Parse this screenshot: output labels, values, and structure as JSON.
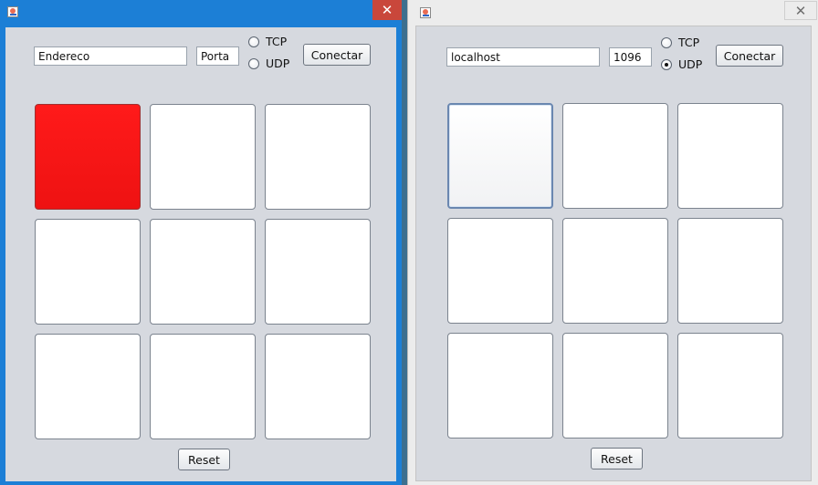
{
  "left_window": {
    "address_value": "Endereco",
    "port_value": "Porta",
    "radio_tcp_label": "TCP",
    "radio_udp_label": "UDP",
    "selected_protocol": "none",
    "connect_label": "Conectar",
    "reset_label": "Reset",
    "board": {
      "cells": [
        "red",
        "empty",
        "empty",
        "empty",
        "empty",
        "empty",
        "empty",
        "empty",
        "empty"
      ],
      "fill_color_red": "#ff1a1a"
    }
  },
  "right_window": {
    "address_value": "localhost",
    "port_value": "1096",
    "radio_tcp_label": "TCP",
    "radio_udp_label": "UDP",
    "selected_protocol": "UDP",
    "connect_label": "Conectar",
    "reset_label": "Reset",
    "board": {
      "cells": [
        "empty",
        "empty",
        "empty",
        "empty",
        "empty",
        "empty",
        "empty",
        "empty",
        "empty"
      ],
      "focused_cell": 0
    }
  },
  "colors": {
    "titlebar_active": "#1c7fd6",
    "titlebar_inactive": "#ececec",
    "panel_bg": "#d6d9df",
    "close_button_active": "#c9473b"
  },
  "icons": {
    "app_icon": "java-coffee-icon",
    "close_icon": "close-icon"
  }
}
